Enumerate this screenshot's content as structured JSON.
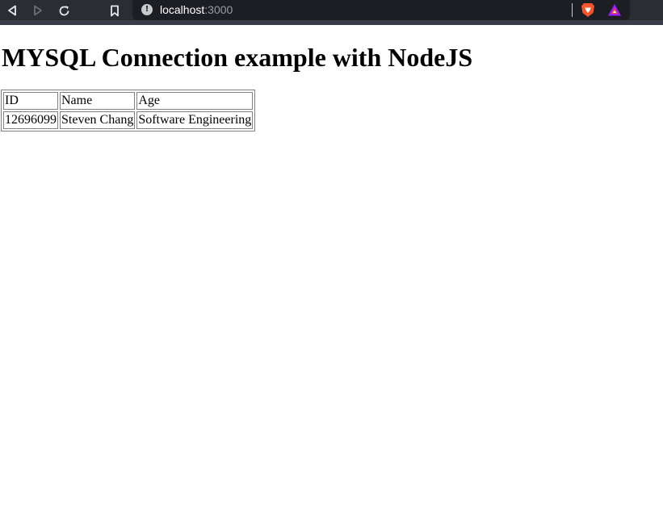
{
  "browser": {
    "url_host": "localhost",
    "url_port": ":3000",
    "colors": {
      "toolbar_bg": "#2b2d35",
      "address_bg": "#1c1e24",
      "brave_orange": "#fb542b",
      "rewards_triangle": "#9e1fff"
    },
    "icons": [
      "back-icon",
      "forward-icon",
      "reload-icon",
      "bookmark-icon",
      "site-info-icon",
      "brave-shields-icon",
      "brave-rewards-icon"
    ]
  },
  "page": {
    "heading": "MYSQL Connection example with NodeJS",
    "table": {
      "headers": [
        "ID",
        "Name",
        "Age"
      ],
      "rows": [
        [
          "12696099",
          "Steven Chang",
          "Software Engineering"
        ]
      ]
    }
  }
}
